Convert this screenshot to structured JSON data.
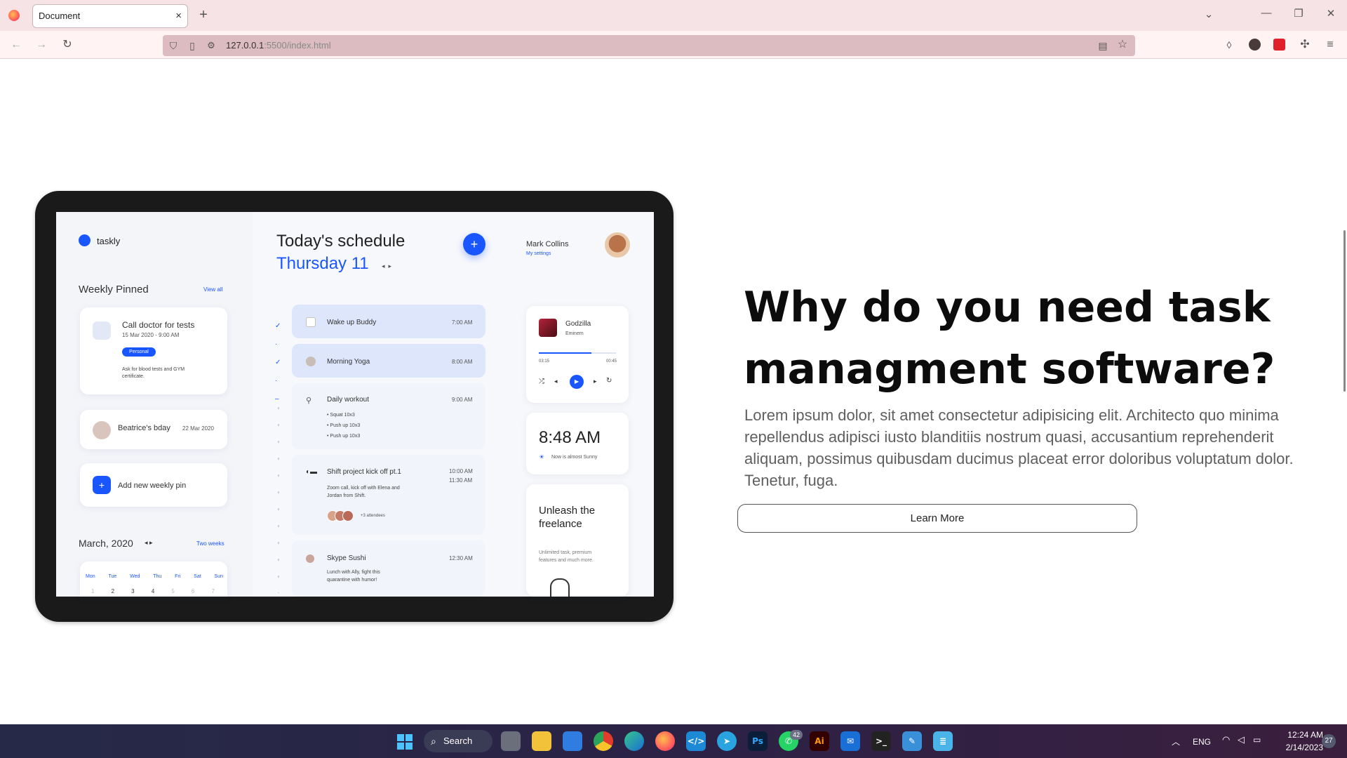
{
  "browser": {
    "tab_title": "Document",
    "tab_close": "×",
    "new_tab": "+",
    "url_host": "127.0.0.1",
    "url_path": ":5500/index.html"
  },
  "tablet": {
    "logo": "taskly",
    "weekly_pinned": "Weekly Pinned",
    "view_all": "View all",
    "pin1_title": "Call doctor for tests",
    "pin1_date": "15 Mar 2020 - 9:00 AM",
    "pin1_tag": "Personal",
    "pin1_note": "Ask for blood tests and GYM certificate.",
    "pin2_title": "Beatrice's bday",
    "pin2_date": "22 Mar 2020",
    "add_pin": "Add new weekly pin",
    "month": "March, 2020",
    "two_weeks": "Two weeks",
    "days": [
      "Mon",
      "Tue",
      "Wed",
      "Thu",
      "Fri",
      "Sat",
      "Sun"
    ],
    "dates": [
      "1",
      "2",
      "3",
      "4",
      "5",
      "6",
      "7"
    ],
    "schedule_title": "Today's schedule",
    "schedule_day": "Thursday 11",
    "user_name": "Mark Collins",
    "user_settings": "My settings",
    "tasks": [
      {
        "title": "Wake up Buddy",
        "time": "7:00 AM"
      },
      {
        "title": "Morning Yoga",
        "time": "8:00 AM"
      },
      {
        "title": "Daily workout",
        "time": "9:00 AM"
      },
      {
        "title": "Shift project kick off pt.1",
        "time": "10:00 AM",
        "time2": "11:30 AM"
      },
      {
        "title": "Skype Sushi",
        "time": "12:30 AM"
      }
    ],
    "workout_items": [
      "Squat 10x3",
      "Push up 10x3",
      "Push up 10x3"
    ],
    "shift_note": "Zoom call, kick off with Elena and Jordan from Shift.",
    "attendees": "+3 attendees",
    "sushi_note": "Lunch with Ally, fight this quarantine with humor!",
    "song": "Godzilla",
    "artist": "Eminem",
    "t_start": "03:15",
    "t_end": "00:45",
    "progress": 0.68,
    "clock": "8:48 AM",
    "weather": "Now is almost Sunny",
    "promo_title": "Unleash the freelance",
    "promo_text": "Unlimited task, premium features and much more."
  },
  "content": {
    "heading": "Why do you need task managment software?",
    "paragraph": "Lorem ipsum dolor, sit amet consectetur adipisicing elit. Architecto quo minima repellendus adipisci iusto blanditiis nostrum quasi, accusantium reprehenderit aliquam, possimus quibusdam ducimus placeat error doloribus voluptatum dolor. Tenetur, fuga.",
    "button": "Learn More"
  },
  "taskbar": {
    "search": "Search",
    "whatsapp_badge": "42",
    "lang": "ENG",
    "time": "12:24 AM",
    "date": "2/14/2023",
    "notif": "27"
  },
  "colors": {
    "accent": "#1a56ff",
    "tab_bar": "#f6e3e5",
    "url_bar": "#dcbcc1"
  }
}
